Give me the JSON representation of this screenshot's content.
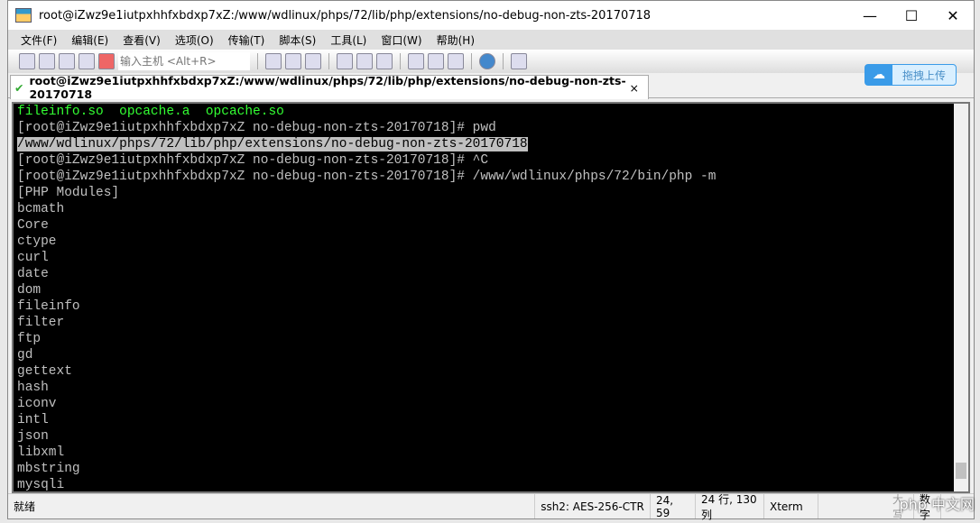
{
  "window": {
    "title": "root@iZwz9e1iutpxhhfxbdxp7xZ:/www/wdlinux/phps/72/lib/php/extensions/no-debug-non-zts-20170718",
    "minimize": "—",
    "maximize": "☐",
    "close": "✕"
  },
  "menu": [
    "文件(F)",
    "编辑(E)",
    "查看(V)",
    "选项(O)",
    "传输(T)",
    "脚本(S)",
    "工具(L)",
    "窗口(W)",
    "帮助(H)"
  ],
  "toolbar": {
    "host_placeholder": "输入主机 <Alt+R>"
  },
  "tab": {
    "label": "root@iZwz9e1iutpxhhfxbdxp7xZ:/www/wdlinux/phps/72/lib/php/extensions/no-debug-non-zts-20170718",
    "close": "×"
  },
  "upload": {
    "label": "拖拽上传"
  },
  "terminal": {
    "ls_line": "fileinfo.so  opcache.a  opcache.so",
    "lines_before": [
      "[root@iZwz9e1iutpxhhfxbdxp7xZ no-debug-non-zts-20170718]# pwd"
    ],
    "highlighted": "/www/wdlinux/phps/72/lib/php/extensions/no-debug-non-zts-20170718",
    "lines_after": [
      "[root@iZwz9e1iutpxhhfxbdxp7xZ no-debug-non-zts-20170718]# ^C",
      "[root@iZwz9e1iutpxhhfxbdxp7xZ no-debug-non-zts-20170718]# /www/wdlinux/phps/72/bin/php -m",
      "[PHP Modules]",
      "bcmath",
      "Core",
      "ctype",
      "curl",
      "date",
      "dom",
      "fileinfo",
      "filter",
      "ftp",
      "gd",
      "gettext",
      "hash",
      "iconv",
      "intl",
      "json",
      "libxml",
      "mbstring",
      "mysqli"
    ]
  },
  "status": {
    "ready": "就绪",
    "cipher": "ssh2: AES-256-CTR",
    "cursor": "24,  59",
    "size": "24 行, 130 列",
    "term": "Xterm",
    "caps": "大写",
    "num": "数字"
  },
  "watermark": "php 中文网"
}
